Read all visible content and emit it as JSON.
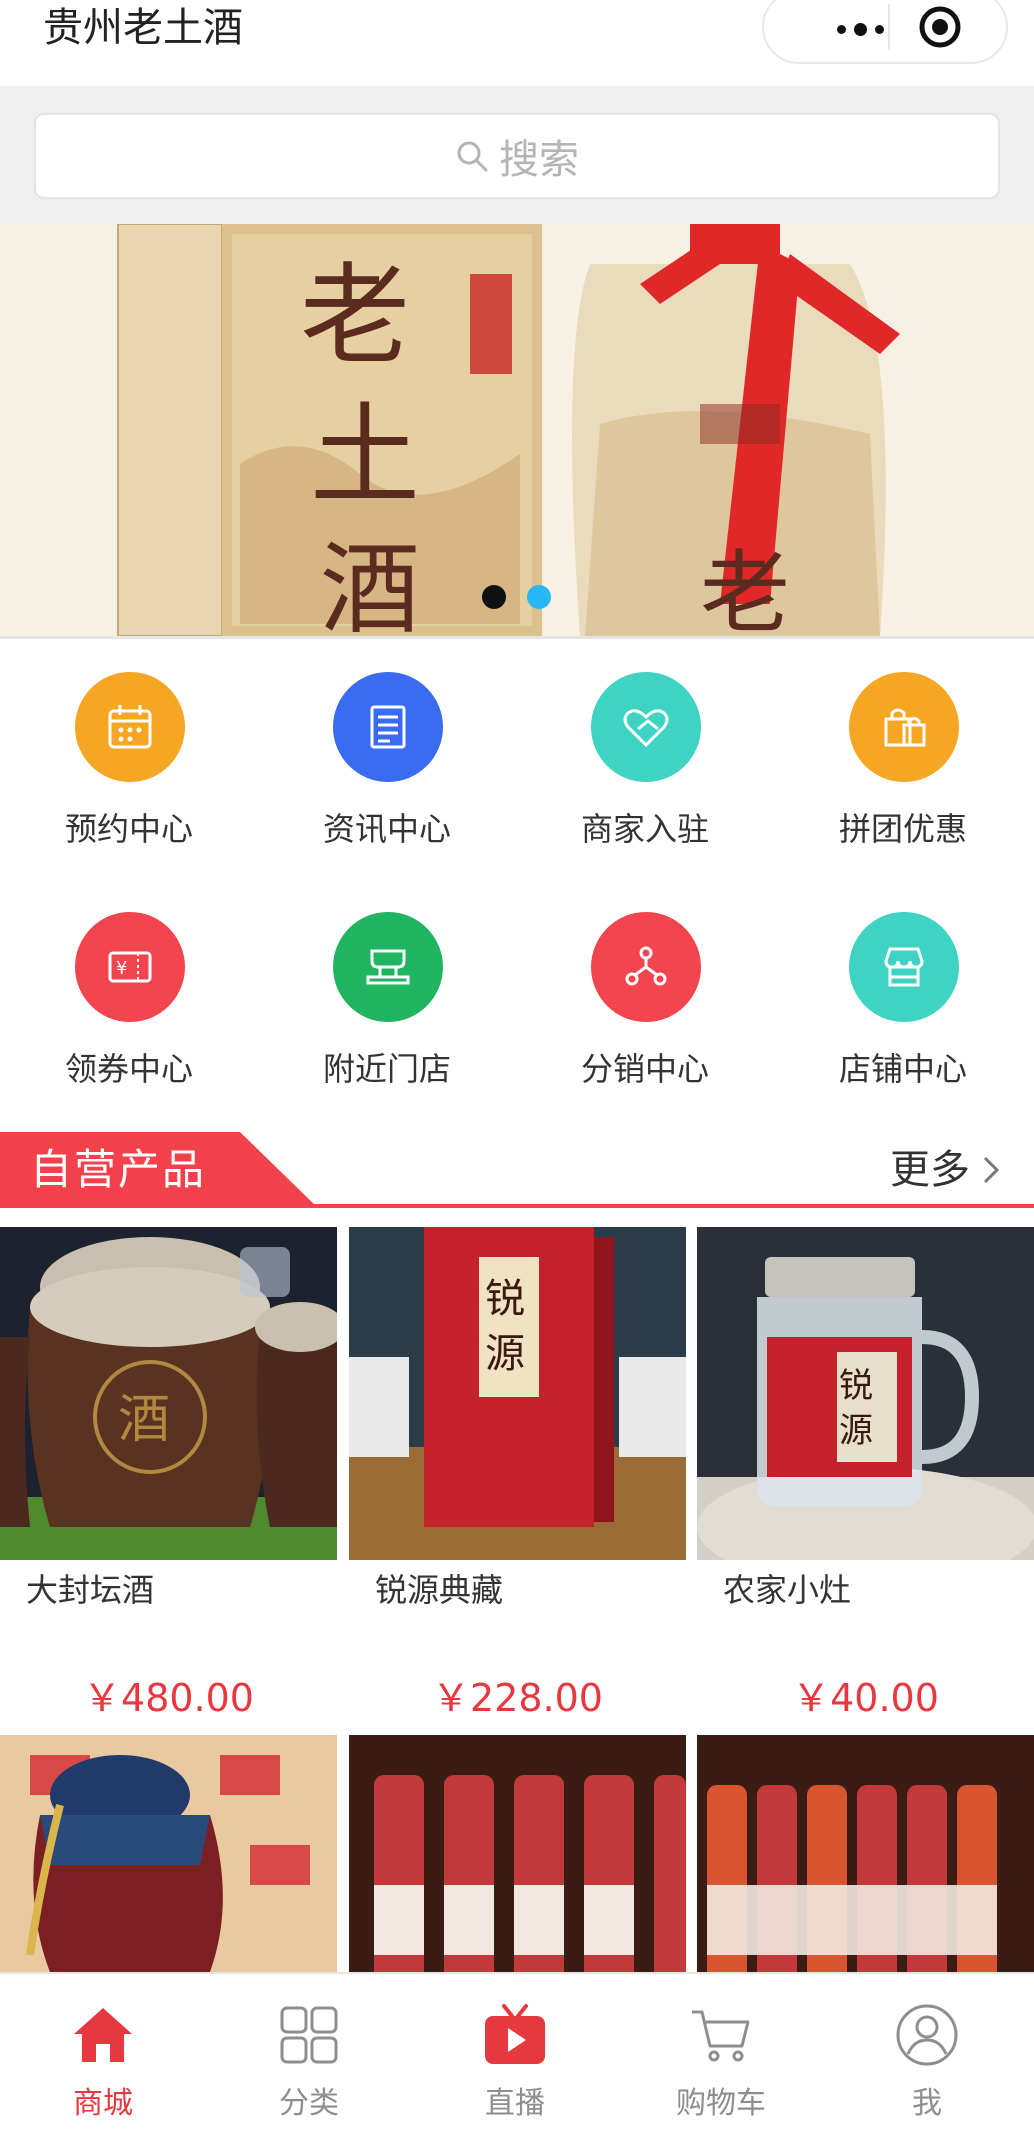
{
  "header": {
    "title": "贵州老土酒"
  },
  "search": {
    "placeholder": "搜索"
  },
  "banner": {
    "slide_count": 2,
    "active_index": 1,
    "colors": {
      "dot_inactive": "#111111",
      "dot_active": "#29b6f6"
    }
  },
  "menu": {
    "items": [
      {
        "label": "预约中心",
        "icon": "calendar-icon",
        "color": "#f5a623"
      },
      {
        "label": "资讯中心",
        "icon": "news-icon",
        "color": "#3a6bf0"
      },
      {
        "label": "商家入驻",
        "icon": "handshake-heart-icon",
        "color": "#3fd3c3"
      },
      {
        "label": "拼团优惠",
        "icon": "shopping-bags-icon",
        "color": "#f5a623"
      },
      {
        "label": "领券中心",
        "icon": "coupon-icon",
        "color": "#f2454d"
      },
      {
        "label": "附近门店",
        "icon": "store-counter-icon",
        "color": "#1fb45f"
      },
      {
        "label": "分销中心",
        "icon": "distribution-icon",
        "color": "#f2454d"
      },
      {
        "label": "店铺中心",
        "icon": "shop-awning-icon",
        "color": "#3fd3c3"
      }
    ]
  },
  "section": {
    "title": "自营产品",
    "more_label": "更多",
    "accent": "#f3414b"
  },
  "products": [
    {
      "name": "大封坛酒",
      "price": "￥480.00"
    },
    {
      "name": "锐源典藏",
      "price": "￥228.00"
    },
    {
      "name": "农家小灶",
      "price": "￥40.00"
    },
    {
      "name": "",
      "price": ""
    },
    {
      "name": "",
      "price": ""
    },
    {
      "name": "",
      "price": ""
    }
  ],
  "tabbar": {
    "active": "商城",
    "items": [
      {
        "label": "商城",
        "icon": "home-icon"
      },
      {
        "label": "分类",
        "icon": "grid-category-icon"
      },
      {
        "label": "直播",
        "icon": "tv-play-icon"
      },
      {
        "label": "购物车",
        "icon": "cart-icon"
      },
      {
        "label": "我",
        "icon": "user-icon"
      }
    ]
  }
}
